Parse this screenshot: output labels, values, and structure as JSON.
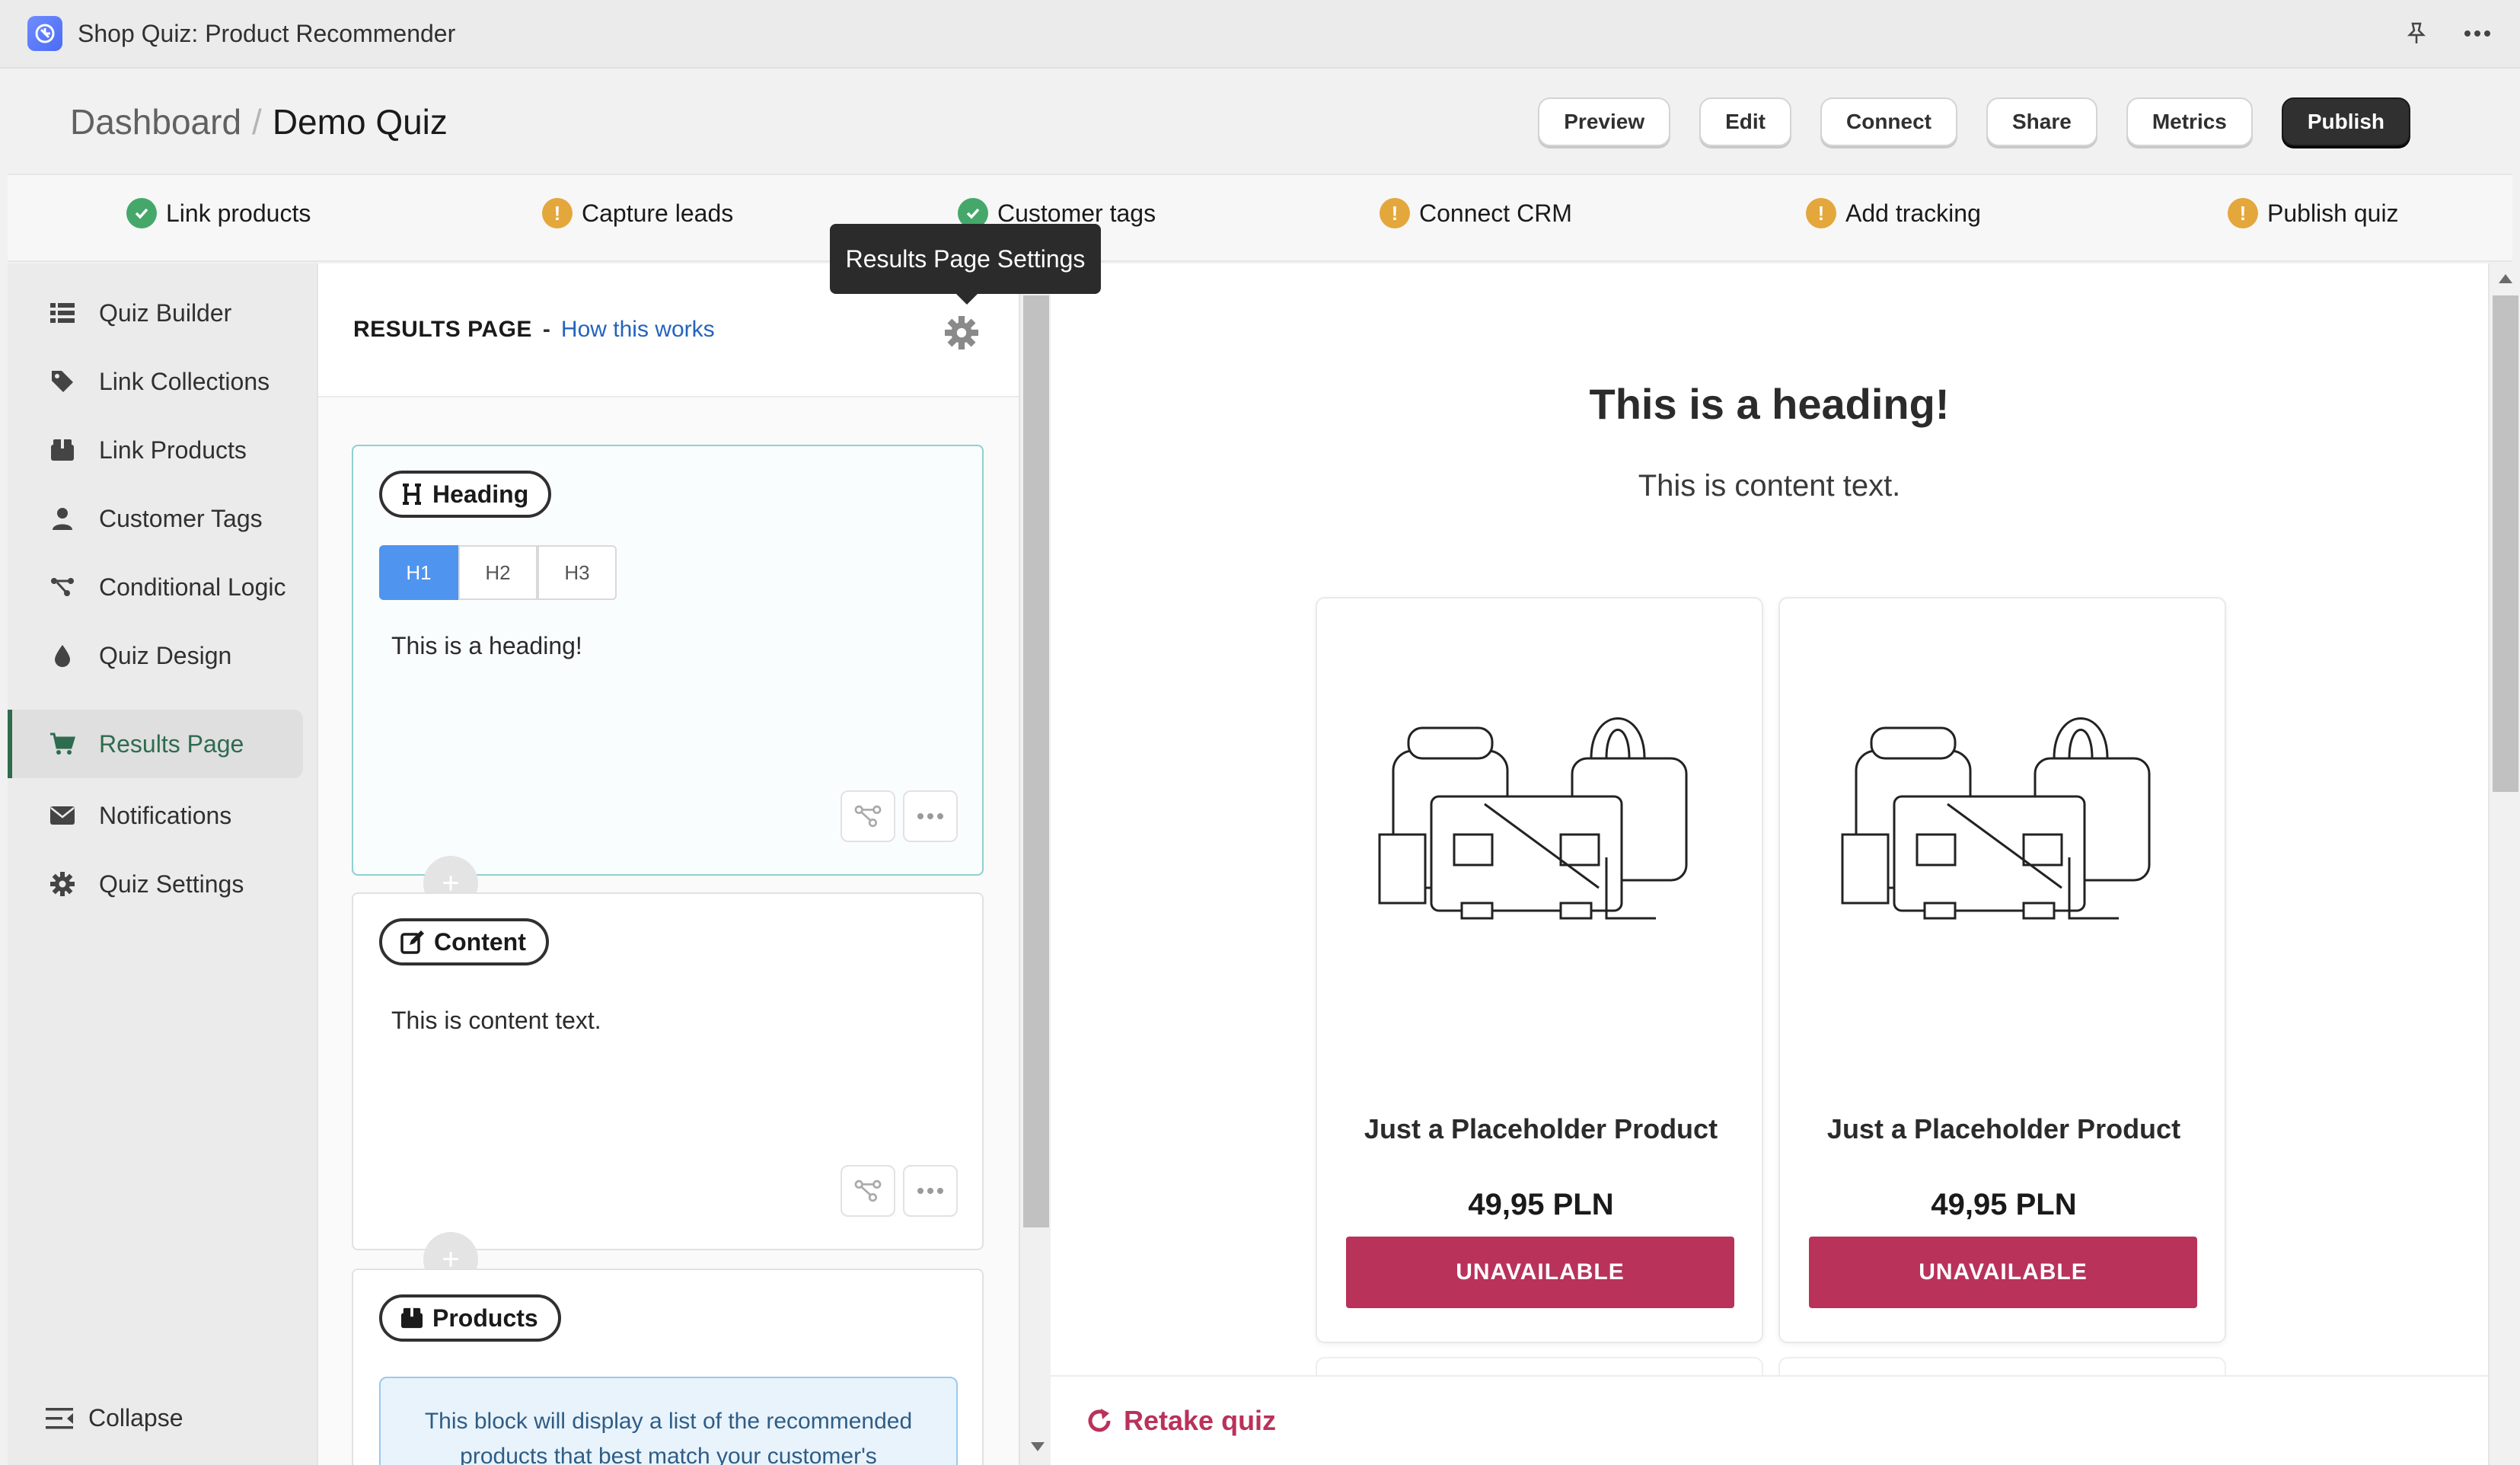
{
  "app": {
    "title": "Shop Quiz: Product Recommender"
  },
  "breadcrumb": {
    "root": "Dashboard",
    "separator": "/",
    "current": "Demo Quiz"
  },
  "header_actions": [
    "Preview",
    "Edit",
    "Connect",
    "Share",
    "Metrics",
    "Publish"
  ],
  "steps": [
    {
      "label": "Link products",
      "status": "done"
    },
    {
      "label": "Capture leads",
      "status": "warning"
    },
    {
      "label": "Customer tags",
      "status": "done"
    },
    {
      "label": "Connect CRM",
      "status": "warning"
    },
    {
      "label": "Add tracking",
      "status": "warning"
    },
    {
      "label": "Publish quiz",
      "status": "warning"
    }
  ],
  "tooltip": "Results Page Settings",
  "sidebar": {
    "items": [
      {
        "label": "Quiz Builder",
        "icon": "list-icon"
      },
      {
        "label": "Link Collections",
        "icon": "tag-icon"
      },
      {
        "label": "Link Products",
        "icon": "box-icon"
      },
      {
        "label": "Customer Tags",
        "icon": "user-icon"
      },
      {
        "label": "Conditional Logic",
        "icon": "branch-icon"
      },
      {
        "label": "Quiz Design",
        "icon": "droplet-icon"
      },
      {
        "label": "Results Page",
        "icon": "cart-icon",
        "active": true
      },
      {
        "label": "Notifications",
        "icon": "envelope-icon"
      },
      {
        "label": "Quiz Settings",
        "icon": "gear-icon"
      }
    ],
    "collapse": "Collapse"
  },
  "editor": {
    "title": "RESULTS PAGE",
    "dash": "-",
    "help_link": "How this works",
    "blocks": {
      "heading": {
        "label": "Heading",
        "tabs": [
          "H1",
          "H2",
          "H3"
        ],
        "active_tab": "H1",
        "text": "This is a heading!"
      },
      "content": {
        "label": "Content",
        "text": "This is content text."
      },
      "products": {
        "label": "Products",
        "info": "This block will display a list of the recommended products that best match your customer's"
      }
    },
    "add_symbol": "+"
  },
  "preview": {
    "heading": "This is a heading!",
    "content": "This is content text.",
    "products": [
      {
        "name": "Just a Placeholder Product",
        "price": "49,95 PLN",
        "button": "UNAVAILABLE"
      },
      {
        "name": "Just a Placeholder Product",
        "price": "49,95 PLN",
        "button": "UNAVAILABLE"
      }
    ],
    "retake": "Retake quiz"
  },
  "colors": {
    "accent_green": "#2e6b4f",
    "ok": "#45a86a",
    "warning": "#e4a73c",
    "product_button": "#b9325a",
    "tab_active": "#4f94ef"
  }
}
